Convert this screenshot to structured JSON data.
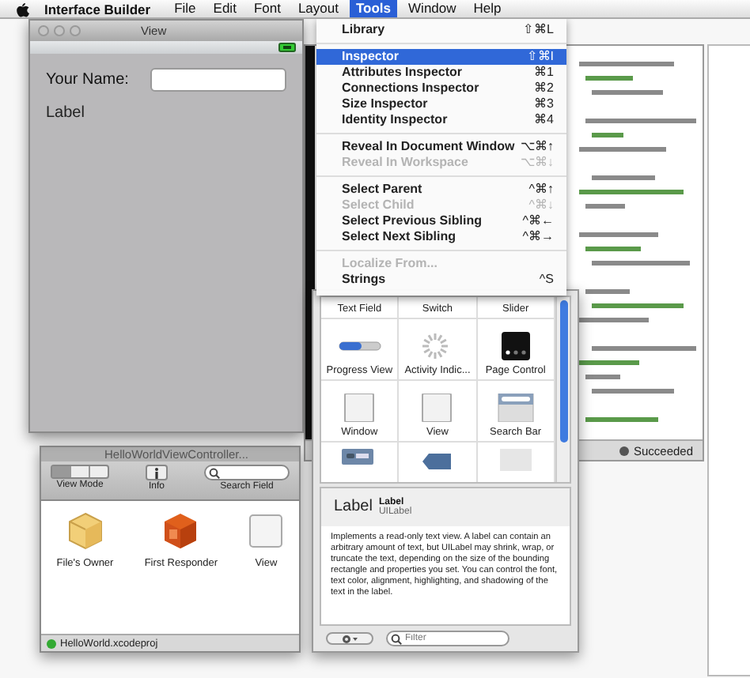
{
  "menu_bar": {
    "app": "Interface Builder",
    "items": [
      {
        "label": "File",
        "selected": false
      },
      {
        "label": "Edit",
        "selected": false
      },
      {
        "label": "Font",
        "selected": false
      },
      {
        "label": "Layout",
        "selected": false
      },
      {
        "label": "Tools",
        "selected": true
      },
      {
        "label": "Window",
        "selected": false
      },
      {
        "label": "Help",
        "selected": false
      }
    ]
  },
  "tools_menu": {
    "items": [
      {
        "kind": "item",
        "label": "Library",
        "shortcut": "⇧⌘L",
        "selected": false,
        "disabled": false
      },
      {
        "kind": "separator"
      },
      {
        "kind": "item",
        "label": "Inspector",
        "shortcut": "⇧⌘I",
        "selected": true,
        "disabled": false
      },
      {
        "kind": "item",
        "label": "Attributes Inspector",
        "shortcut": "⌘1",
        "selected": false,
        "disabled": false
      },
      {
        "kind": "item",
        "label": "Connections Inspector",
        "shortcut": "⌘2",
        "selected": false,
        "disabled": false
      },
      {
        "kind": "item",
        "label": "Size Inspector",
        "shortcut": "⌘3",
        "selected": false,
        "disabled": false
      },
      {
        "kind": "item",
        "label": "Identity Inspector",
        "shortcut": "⌘4",
        "selected": false,
        "disabled": false
      },
      {
        "kind": "separator"
      },
      {
        "kind": "item",
        "label": "Reveal In Document Window",
        "shortcut": "⌥⌘↑",
        "selected": false,
        "disabled": false
      },
      {
        "kind": "item",
        "label": "Reveal In Workspace",
        "shortcut": "⌥⌘↓",
        "selected": false,
        "disabled": true
      },
      {
        "kind": "separator"
      },
      {
        "kind": "item",
        "label": "Select Parent",
        "shortcut": "^⌘↑",
        "selected": false,
        "disabled": false
      },
      {
        "kind": "item",
        "label": "Select Child",
        "shortcut": "^⌘↓",
        "selected": false,
        "disabled": true
      },
      {
        "kind": "item",
        "label": "Select Previous Sibling",
        "shortcut": "^⌘←",
        "selected": false,
        "disabled": false
      },
      {
        "kind": "item",
        "label": "Select Next Sibling",
        "shortcut": "^⌘→",
        "selected": false,
        "disabled": false
      },
      {
        "kind": "separator"
      },
      {
        "kind": "item",
        "label": "Localize From...",
        "selected": false,
        "disabled": true
      },
      {
        "kind": "item",
        "label": "Strings",
        "shortcut": "^S",
        "selected": false,
        "disabled": false
      }
    ]
  },
  "view_window": {
    "title": "View",
    "name_label": "Your Name:",
    "label": "Label"
  },
  "document_window": {
    "title": "HelloWorldViewController...",
    "toolbar": [
      {
        "kind": "view-mode",
        "label": "View Mode"
      },
      {
        "kind": "info",
        "label": "Info"
      },
      {
        "kind": "search",
        "label": "Search Field"
      }
    ],
    "objects": [
      {
        "kind": "cube",
        "label": "File's Owner"
      },
      {
        "kind": "responder",
        "label": "First Responder"
      },
      {
        "kind": "view",
        "label": "View"
      }
    ],
    "status": "HelloWorld.xcodeproj"
  },
  "library": {
    "cells": [
      {
        "kind": "none",
        "label": "Text Field"
      },
      {
        "kind": "none",
        "label": "Switch"
      },
      {
        "kind": "none",
        "label": "Slider"
      },
      {
        "kind": "progress",
        "label": "Progress View"
      },
      {
        "kind": "activity",
        "label": "Activity Indic..."
      },
      {
        "kind": "page-control",
        "label": "Page Control"
      },
      {
        "kind": "window",
        "label": "Window"
      },
      {
        "kind": "view",
        "label": "View"
      },
      {
        "kind": "search-bar",
        "label": "Search Bar"
      },
      {
        "kind": "nav-bar"
      },
      {
        "kind": "back-button"
      },
      {
        "kind": "plain"
      }
    ],
    "detail": {
      "sample": "Label",
      "name": "Label",
      "class_name": "UILabel",
      "description": "Implements a read-only text view. A label can contain an arbitrary amount of text, but UILabel may shrink, wrap, or truncate the text, depending on the size of the bounding rectangle and properties you set. You can control the font, text color, alignment, highlighting, and shadowing of the text in the label."
    },
    "filter": {
      "placeholder": "Filter"
    }
  },
  "editor_window": {
    "status": "Succeeded"
  }
}
